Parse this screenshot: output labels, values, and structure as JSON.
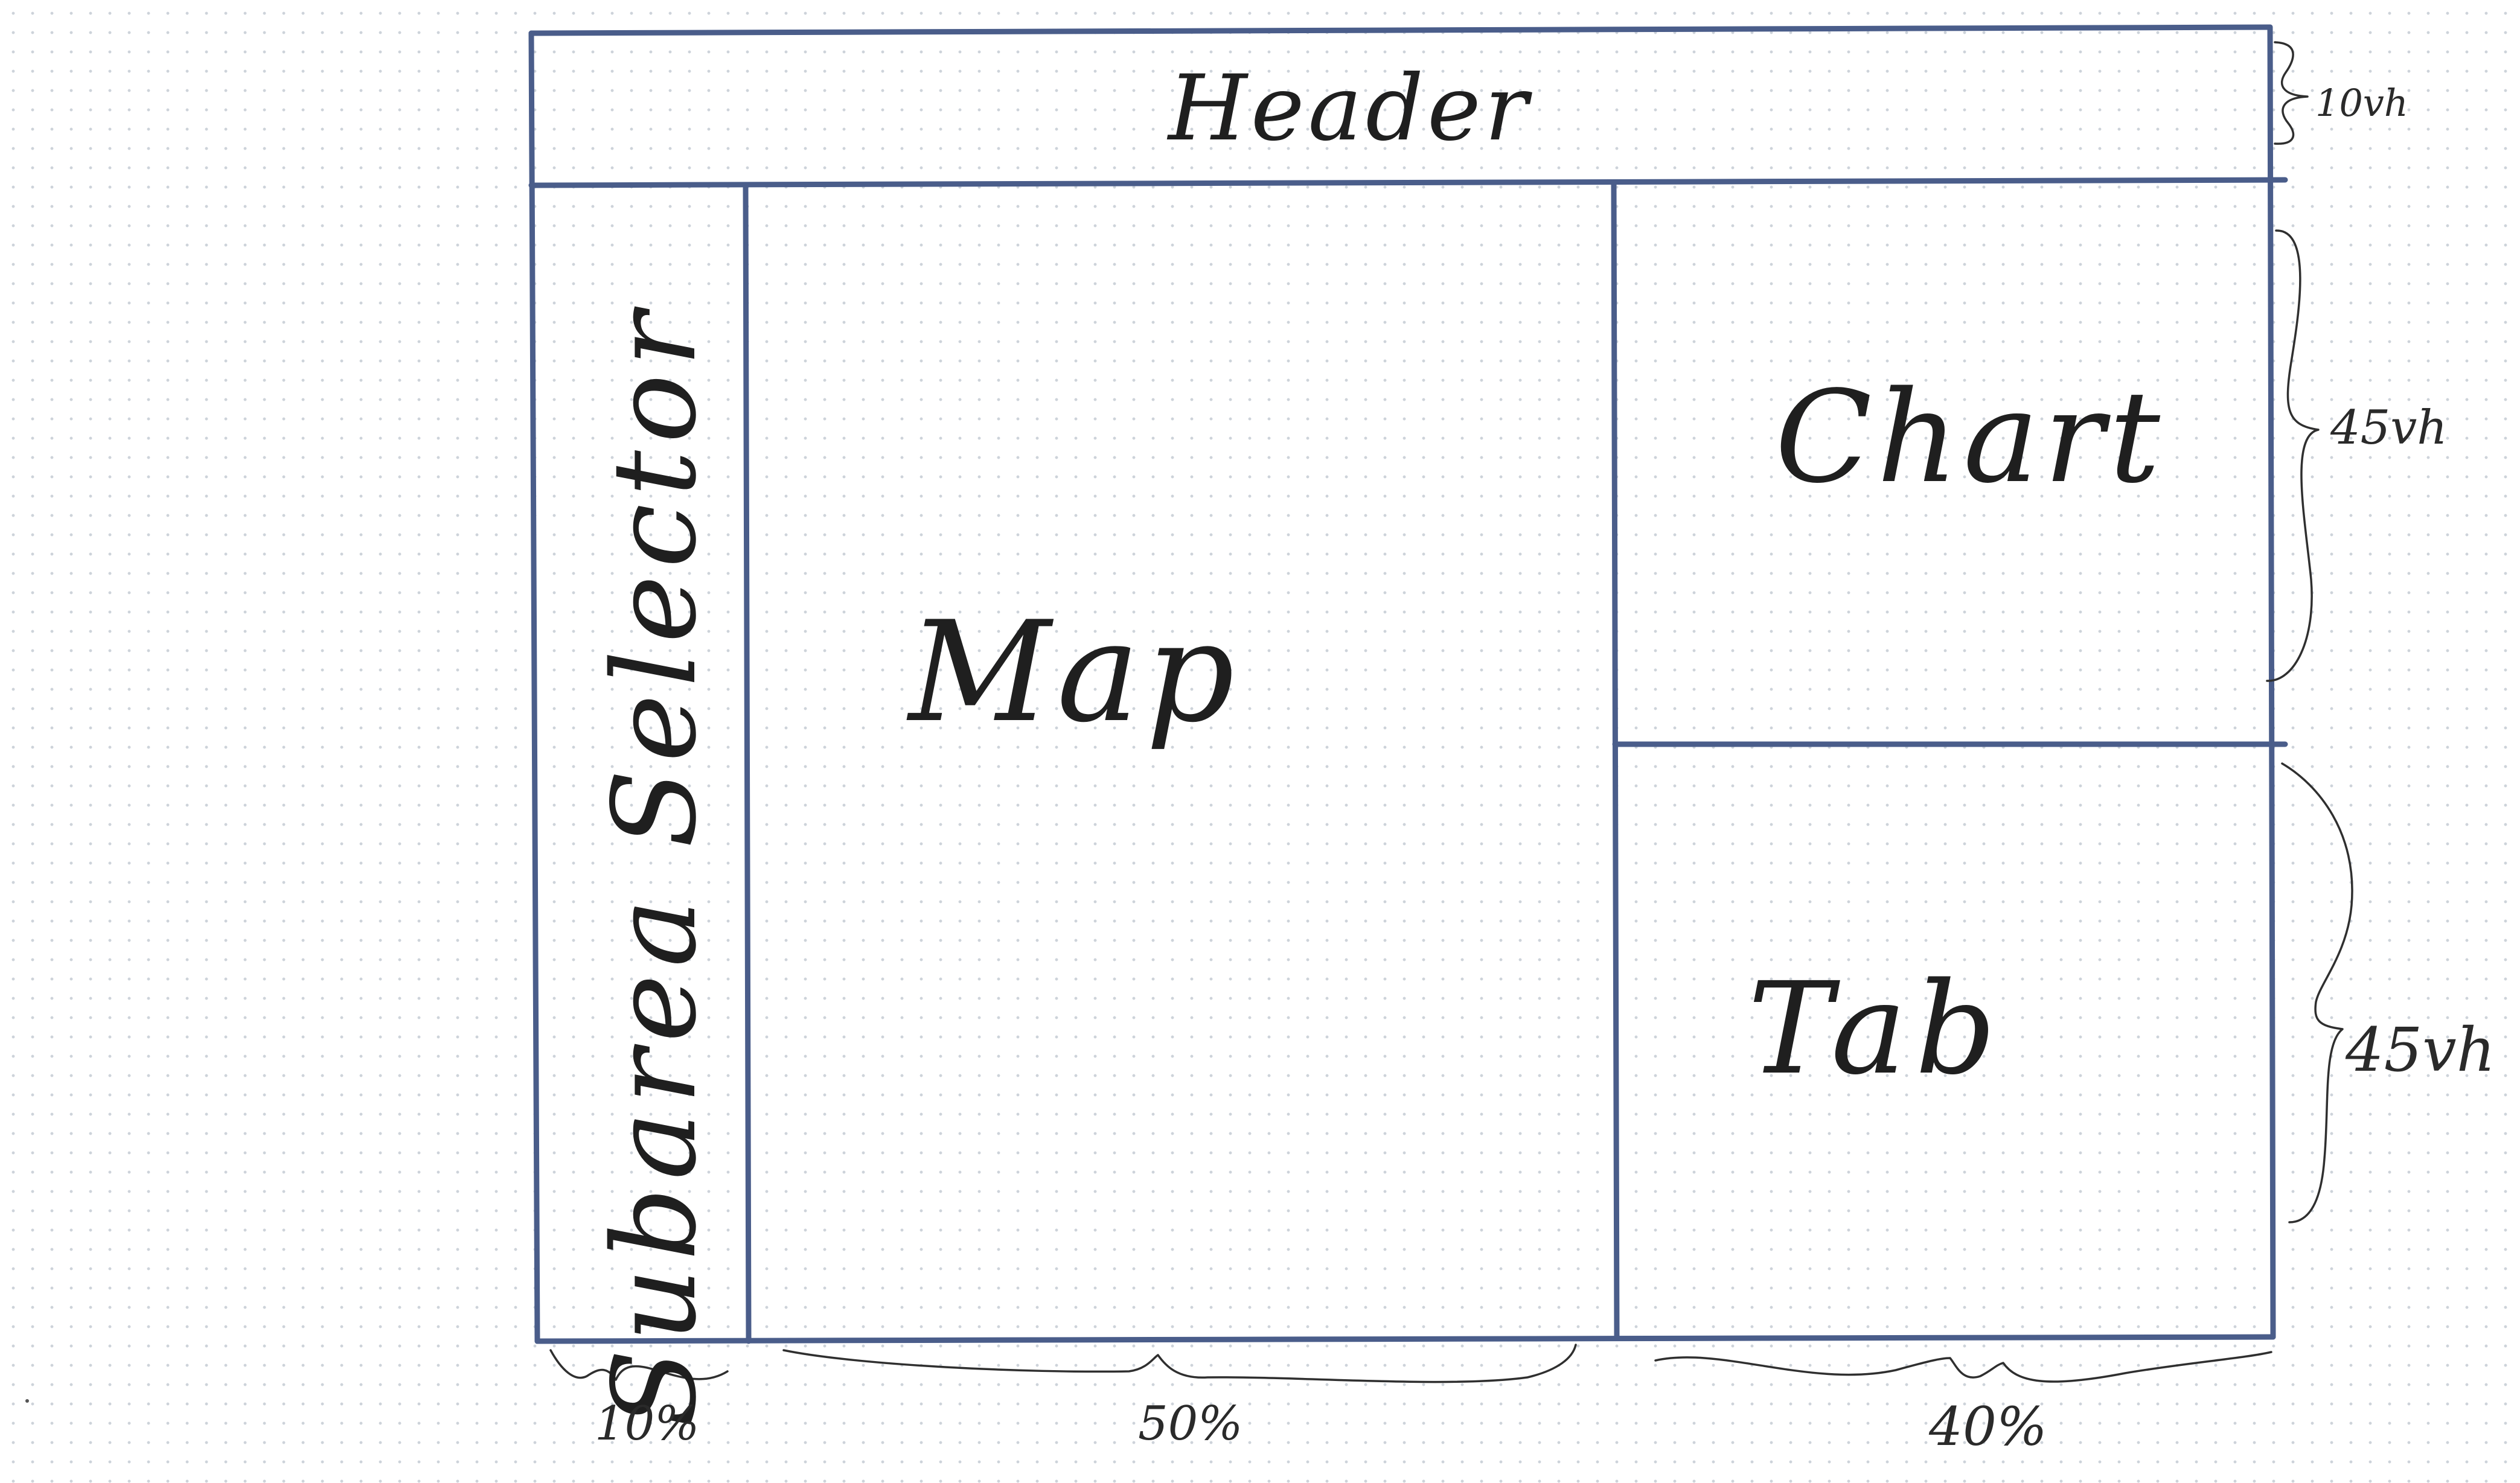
{
  "colors": {
    "frame_line": "#4a5d8a",
    "ink": "#1f1f1f"
  },
  "regions": {
    "header": "Header",
    "subarea_selector": "Subarea Selector",
    "map": "Map",
    "chart": "Chart",
    "tab": "Tab"
  },
  "dimensions": {
    "header_height": "10vh",
    "chart_height": "45vh",
    "tab_height": "45vh",
    "subarea_width": "10%",
    "map_width": "50%",
    "right_column_width": "40%"
  }
}
